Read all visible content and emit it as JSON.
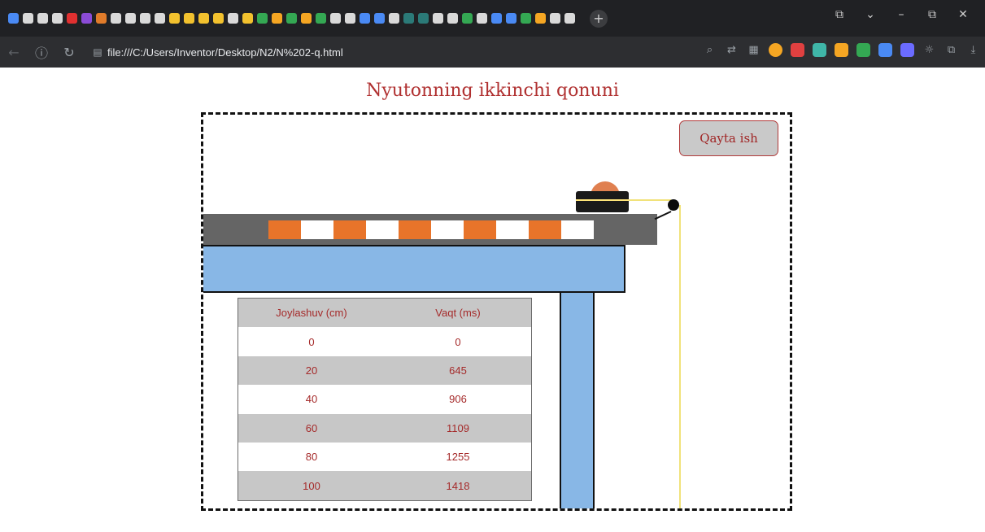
{
  "browser": {
    "tab_icon_colors": [
      "#4a8af4",
      "#d9d9d9",
      "#d9d9d9",
      "#d9d9d9",
      "#e03030",
      "#8b4bd6",
      "#e07b2a",
      "#d9d9d9",
      "#d9d9d9",
      "#d9d9d9",
      "#d9d9d9",
      "#f2c12e",
      "#f2c12e",
      "#f2c12e",
      "#f2c12e",
      "#d9d9d9",
      "#f2c12e",
      "#34a853",
      "#f5a623",
      "#34a853",
      "#f5a623",
      "#34a853",
      "#d9d9d9",
      "#d9d9d9",
      "#4a8af4",
      "#4a8af4",
      "#d9d9d9",
      "#2b7a78",
      "#2b7a78",
      "#d9d9d9",
      "#d9d9d9",
      "#34a853",
      "#d9d9d9",
      "#4a8af4",
      "#4a8af4",
      "#34a853",
      "#f5a623",
      "#d9d9d9",
      "#d9d9d9"
    ],
    "new_tab_glyph": "+",
    "window_controls": [
      "⧉",
      "⌄",
      "–",
      "⧉",
      "✕"
    ],
    "url": "file:///C:/Users/Inventor/Desktop/N2/N%202-q.html",
    "extension_colors": [
      "#f5a623",
      "#e04040",
      "#3fb6a8",
      "#f5a623",
      "#34a853",
      "#4a8af4",
      "#6b6bff"
    ]
  },
  "page": {
    "title": "Nyutonning ikkinchi qonuni",
    "restart_label": "Qayta ish"
  },
  "table": {
    "headers": [
      "Joylashuv (cm)",
      "Vaqt (ms)"
    ],
    "rows": [
      [
        "0",
        "0"
      ],
      [
        "20",
        "645"
      ],
      [
        "40",
        "906"
      ],
      [
        "60",
        "1109"
      ],
      [
        "80",
        "1255"
      ],
      [
        "100",
        "1418"
      ]
    ]
  },
  "colors": {
    "title": "#b03030",
    "track_orange": "#e8742a",
    "table_blue": "#88b7e6"
  }
}
